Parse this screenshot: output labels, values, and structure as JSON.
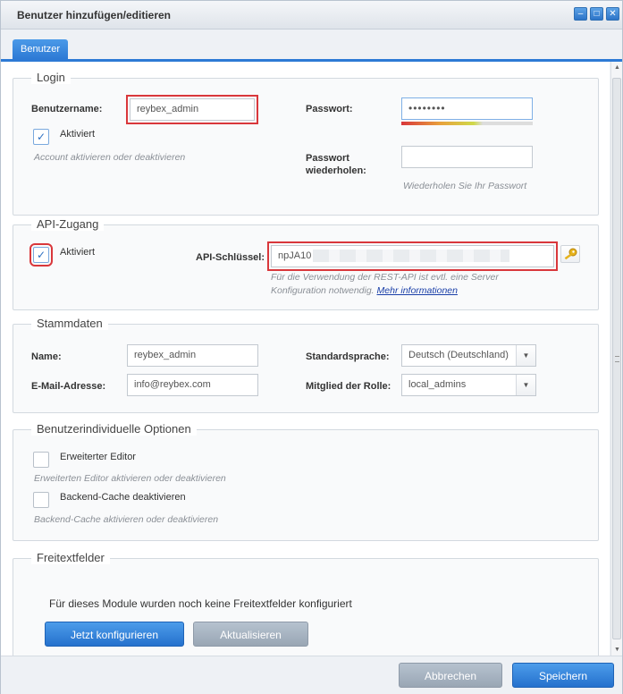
{
  "window": {
    "title": "Benutzer hinzufügen/editieren"
  },
  "tabs": [
    {
      "label": "Benutzer"
    }
  ],
  "login": {
    "legend": "Login",
    "username_label": "Benutzername:",
    "username_value": "reybex_admin",
    "active_label": "Aktiviert",
    "active_checked": true,
    "active_hint": "Account aktivieren oder deaktivieren",
    "password_label": "Passwort:",
    "password_value": "••••••••",
    "password_repeat_label_line1": "Passwort",
    "password_repeat_label_line2": "wiederholen:",
    "password_repeat_value": "",
    "password_repeat_hint": "Wiederholen Sie Ihr Passwort"
  },
  "api": {
    "legend": "API-Zugang",
    "active_label": "Aktiviert",
    "active_checked": true,
    "key_label": "API-Schlüssel:",
    "key_value": "npJA10",
    "key_icon": "key-icon",
    "hint_line1": "Für die Verwendung der REST-API ist evtl. eine Server",
    "hint_line2": "Konfiguration notwendig.",
    "more_link": "Mehr informationen"
  },
  "stammdaten": {
    "legend": "Stammdaten",
    "name_label": "Name:",
    "name_value": "reybex_admin",
    "email_label": "E-Mail-Adresse:",
    "email_value": "info@reybex.com",
    "language_label": "Standardsprache:",
    "language_value": "Deutsch (Deutschland)",
    "role_label": "Mitglied der Rolle:",
    "role_value": "local_admins"
  },
  "options": {
    "legend": "Benutzerindividuelle Optionen",
    "editor_label": "Erweiterter Editor",
    "editor_hint": "Erweiterten Editor aktivieren oder deaktivieren",
    "cache_label": "Backend-Cache deaktivieren",
    "cache_hint": "Backend-Cache aktivieren oder deaktivieren"
  },
  "freitext": {
    "legend": "Freitextfelder",
    "message": "Für dieses Module wurden noch keine Freitextfelder konfiguriert",
    "configure_button": "Jetzt konfigurieren",
    "refresh_button": "Aktualisieren"
  },
  "footer": {
    "cancel_button": "Abbrechen",
    "save_button": "Speichern"
  },
  "colors": {
    "accent": "#2d7ad5",
    "highlight": "#d9373b"
  }
}
